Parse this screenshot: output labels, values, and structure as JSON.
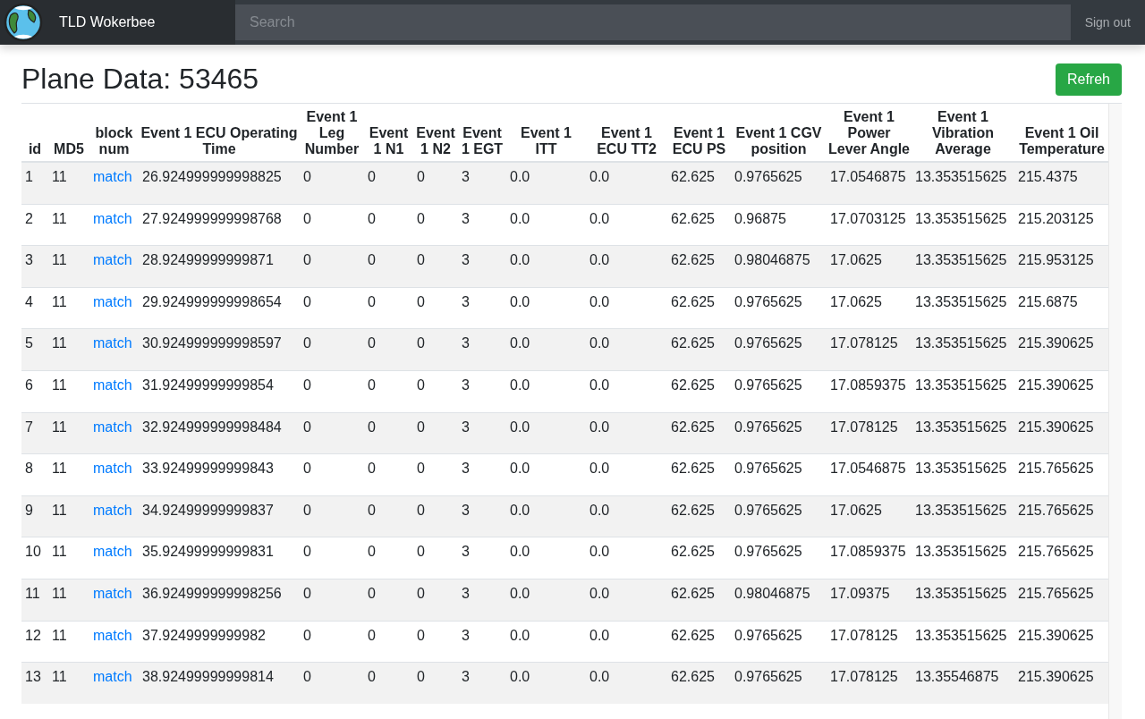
{
  "navbar": {
    "brand": "TLD Wokerbee",
    "search": {
      "placeholder": "Search"
    },
    "sign_out": "Sign out"
  },
  "page": {
    "title": "Plane Data: 53465",
    "refresh_button": "Refreh"
  },
  "table": {
    "columns": [
      "id",
      "MD5",
      "block num",
      "Event 1 ECU Operating Time",
      "Event 1 Leg Number",
      "Event 1 N1",
      "Event 1 N2",
      "Event 1 EGT",
      "Event 1 ITT",
      "Event 1 ECU TT2",
      "Event 1 ECU PS",
      "Event 1 CGV position",
      "Event 1 Power Lever Angle",
      "Event 1 Vibration Average",
      "Event 1 Oil Temperature"
    ],
    "rows": [
      {
        "id": "1",
        "md5": "11",
        "block_num": "match",
        "values": [
          "26.924999999998825",
          "0",
          "0",
          "0",
          "3",
          "0.0",
          "0.0",
          "62.625",
          "0.9765625",
          "17.0546875",
          "13.353515625",
          "215.4375"
        ]
      },
      {
        "id": "2",
        "md5": "11",
        "block_num": "match",
        "values": [
          "27.924999999998768",
          "0",
          "0",
          "0",
          "3",
          "0.0",
          "0.0",
          "62.625",
          "0.96875",
          "17.0703125",
          "13.353515625",
          "215.203125"
        ]
      },
      {
        "id": "3",
        "md5": "11",
        "block_num": "match",
        "values": [
          "28.92499999999871",
          "0",
          "0",
          "0",
          "3",
          "0.0",
          "0.0",
          "62.625",
          "0.98046875",
          "17.0625",
          "13.353515625",
          "215.953125"
        ]
      },
      {
        "id": "4",
        "md5": "11",
        "block_num": "match",
        "values": [
          "29.924999999998654",
          "0",
          "0",
          "0",
          "3",
          "0.0",
          "0.0",
          "62.625",
          "0.9765625",
          "17.0625",
          "13.353515625",
          "215.6875"
        ]
      },
      {
        "id": "5",
        "md5": "11",
        "block_num": "match",
        "values": [
          "30.924999999998597",
          "0",
          "0",
          "0",
          "3",
          "0.0",
          "0.0",
          "62.625",
          "0.9765625",
          "17.078125",
          "13.353515625",
          "215.390625"
        ]
      },
      {
        "id": "6",
        "md5": "11",
        "block_num": "match",
        "values": [
          "31.92499999999854",
          "0",
          "0",
          "0",
          "3",
          "0.0",
          "0.0",
          "62.625",
          "0.9765625",
          "17.0859375",
          "13.353515625",
          "215.390625"
        ]
      },
      {
        "id": "7",
        "md5": "11",
        "block_num": "match",
        "values": [
          "32.924999999998484",
          "0",
          "0",
          "0",
          "3",
          "0.0",
          "0.0",
          "62.625",
          "0.9765625",
          "17.078125",
          "13.353515625",
          "215.390625"
        ]
      },
      {
        "id": "8",
        "md5": "11",
        "block_num": "match",
        "values": [
          "33.92499999999843",
          "0",
          "0",
          "0",
          "3",
          "0.0",
          "0.0",
          "62.625",
          "0.9765625",
          "17.0546875",
          "13.353515625",
          "215.765625"
        ]
      },
      {
        "id": "9",
        "md5": "11",
        "block_num": "match",
        "values": [
          "34.92499999999837",
          "0",
          "0",
          "0",
          "3",
          "0.0",
          "0.0",
          "62.625",
          "0.9765625",
          "17.0625",
          "13.353515625",
          "215.765625"
        ]
      },
      {
        "id": "10",
        "md5": "11",
        "block_num": "match",
        "values": [
          "35.92499999999831",
          "0",
          "0",
          "0",
          "3",
          "0.0",
          "0.0",
          "62.625",
          "0.9765625",
          "17.0859375",
          "13.353515625",
          "215.765625"
        ]
      },
      {
        "id": "11",
        "md5": "11",
        "block_num": "match",
        "values": [
          "36.924999999998256",
          "0",
          "0",
          "0",
          "3",
          "0.0",
          "0.0",
          "62.625",
          "0.98046875",
          "17.09375",
          "13.353515625",
          "215.765625"
        ]
      },
      {
        "id": "12",
        "md5": "11",
        "block_num": "match",
        "values": [
          "37.9249999999982",
          "0",
          "0",
          "0",
          "3",
          "0.0",
          "0.0",
          "62.625",
          "0.9765625",
          "17.078125",
          "13.353515625",
          "215.390625"
        ]
      },
      {
        "id": "13",
        "md5": "11",
        "block_num": "match",
        "values": [
          "38.92499999999814",
          "0",
          "0",
          "0",
          "3",
          "0.0",
          "0.0",
          "62.625",
          "0.9765625",
          "17.078125",
          "13.35546875",
          "215.390625"
        ]
      }
    ]
  }
}
